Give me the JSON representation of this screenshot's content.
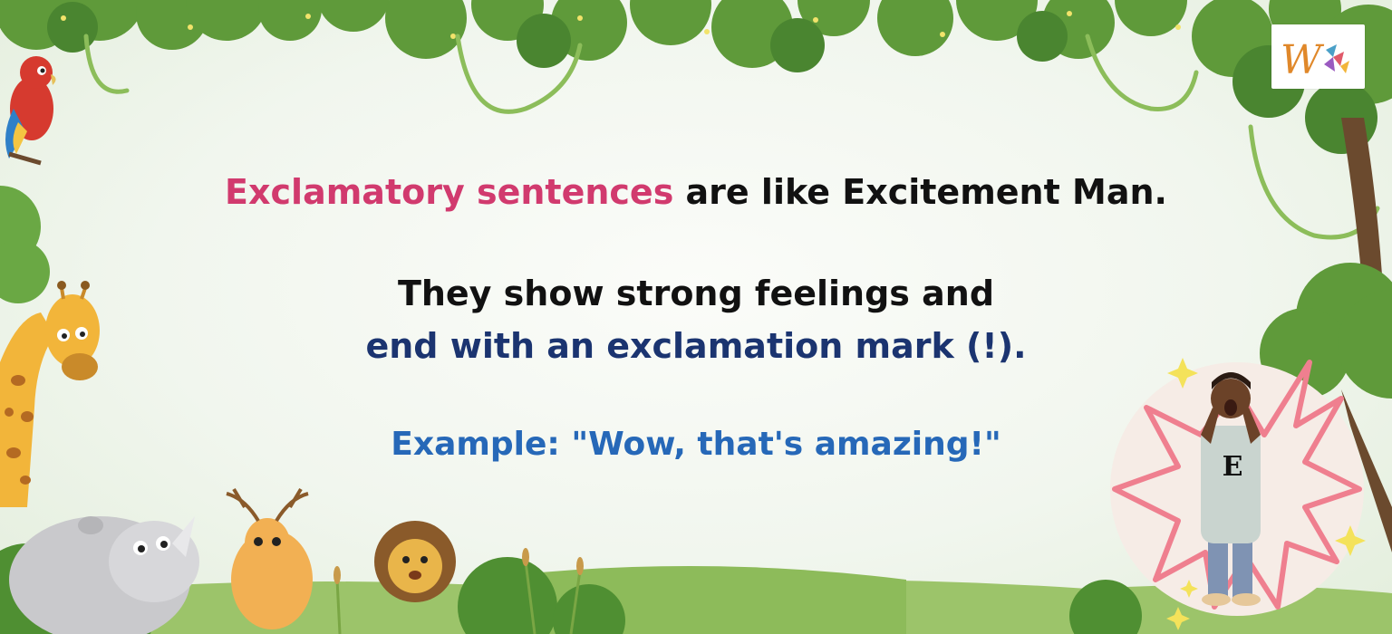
{
  "slide": {
    "line1_highlight": "Exclamatory sentences",
    "line1_rest": " are like Excitement Man.",
    "line2": "They show strong feelings and",
    "line3": "end with an exclamation mark (!).",
    "line4": "Example: \"Wow, that's amazing!\""
  },
  "character": {
    "shirt_letter": "E"
  },
  "logo": {
    "letter": "W"
  },
  "colors": {
    "highlight": "#d13a6e",
    "body_text": "#111111",
    "navy_text": "#1b3470",
    "example_text": "#2668b8",
    "foliage": "#5f9a3a",
    "starburst": "#ef7f8f"
  }
}
